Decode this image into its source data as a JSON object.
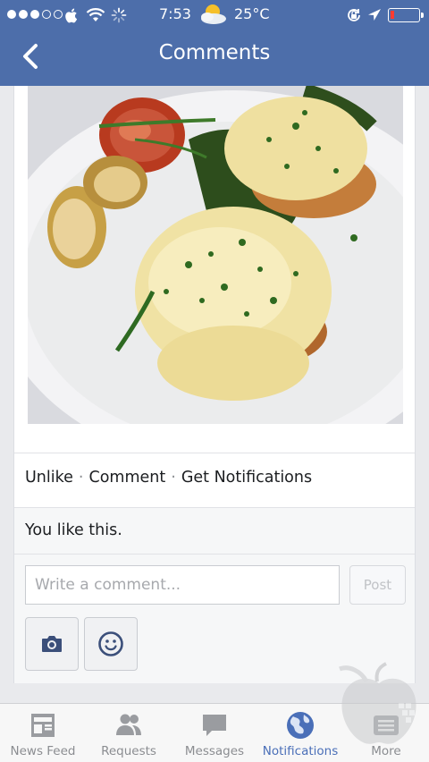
{
  "status_bar": {
    "time": "7:53",
    "temperature": "25°C",
    "signal_dots": 5,
    "signal_filled": 3,
    "battery_level_fraction": 0.12,
    "battery_color": "#ff3b30"
  },
  "nav": {
    "title": "Comments"
  },
  "post": {
    "photo_icon": "food-photo",
    "actions": {
      "unlike": "Unlike",
      "comment": "Comment",
      "notifications": "Get Notifications"
    },
    "likes_text": "You like this."
  },
  "composer": {
    "placeholder": "Write a comment...",
    "post_label": "Post",
    "camera_icon": "camera-icon",
    "emoji_icon": "smiley-icon"
  },
  "tabs": [
    {
      "label": "News Feed",
      "icon": "news-feed-icon",
      "active": false
    },
    {
      "label": "Requests",
      "icon": "friends-icon",
      "active": false
    },
    {
      "label": "Messages",
      "icon": "chat-bubble-icon",
      "active": false
    },
    {
      "label": "Notifications",
      "icon": "globe-icon",
      "active": true
    },
    {
      "label": "More",
      "icon": "menu-icon",
      "active": false
    }
  ],
  "colors": {
    "brand": "#4d6eaa",
    "active_tab": "#4a6fb8"
  }
}
